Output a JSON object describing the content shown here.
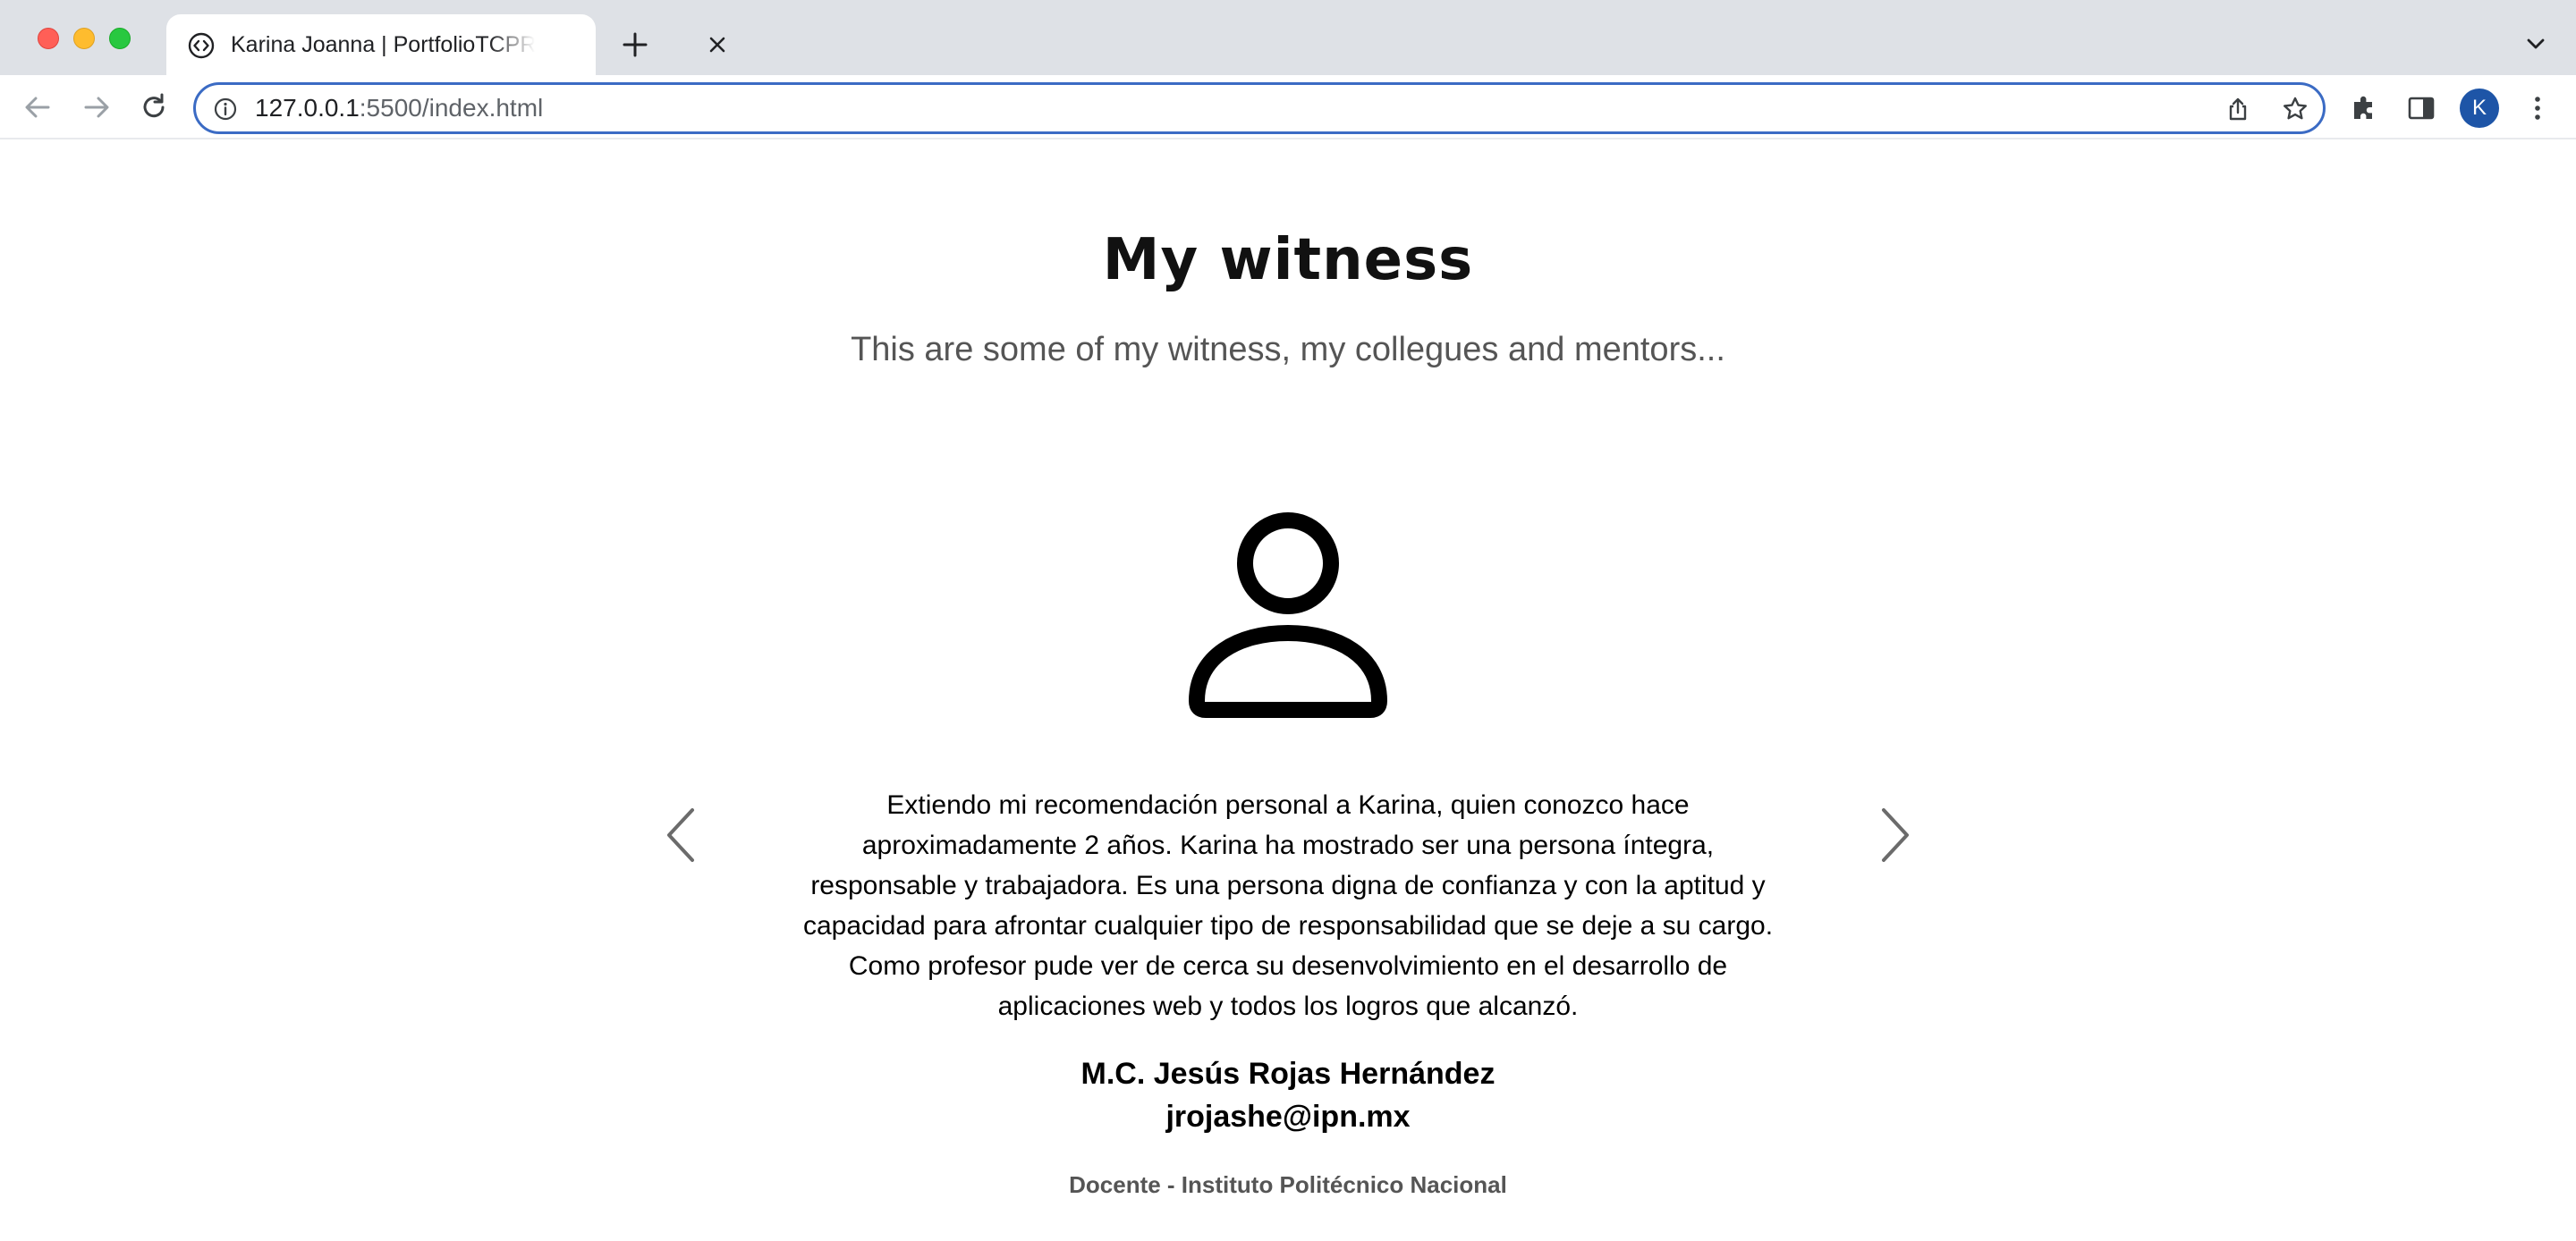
{
  "browser": {
    "tab": {
      "title": "Karina Joanna | PortfolioTCPRO"
    },
    "address_bar": {
      "host": "127.0.0.1",
      "path": ":5500/index.html"
    },
    "profile_initial": "K",
    "colors": {
      "omnibox_focus": "#3b6bc4",
      "profile_avatar": "#1e55a7",
      "tabstrip": "#dee1e6"
    }
  },
  "testimonials": {
    "title": "My witness",
    "subtitle": "This are some of my witness, my collegues and mentors...",
    "current": {
      "text": "Extiendo mi recomendación personal a Karina, quien conozco hace aproximadamente 2 años. Karina ha mostrado ser una persona íntegra, responsable y trabajadora. Es una persona digna de confianza y con la aptitud y capacidad para afrontar cualquier tipo de responsabilidad que se deje a su cargo. Como profesor pude ver de cerca su desenvolvimiento en el desarrollo de aplicaciones web y todos los logros que alcanzó.",
      "author_name": "M.C. Jesús Rojas Hernández",
      "author_email": "jrojashe@ipn.mx",
      "author_role": "Docente - Instituto Politécnico Nacional"
    },
    "icons": {
      "avatar": "person-outline-icon",
      "prev": "chevron-left-icon",
      "next": "chevron-right-icon"
    }
  }
}
